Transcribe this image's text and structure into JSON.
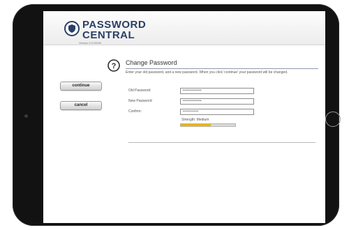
{
  "app": {
    "brand_line_1": "PASSWORD",
    "brand_line_2": "CENTRAL",
    "version": "Version 9.3.05290"
  },
  "page": {
    "title": "Change Password",
    "instructions": "Enter your old password, and a new password. When you click 'continue' your password will be changed."
  },
  "actions": {
    "continue_label": "continue",
    "cancel_label": "cancel"
  },
  "form": {
    "old_password_label": "Old Password:",
    "old_password_value": "••••••••••••",
    "new_password_label": "New Password:",
    "new_password_value": "••••••••••••",
    "confirm_label": "Confirm:",
    "confirm_value": "••••••••••"
  },
  "strength": {
    "label": "Strength: Medium",
    "fraction": 0.55,
    "color": "#f0b400"
  },
  "icons": {
    "logo": "shield-icon",
    "help": "question-mark-icon"
  },
  "colors": {
    "brand": "#2a3f66",
    "device_bezel": "#121212"
  }
}
